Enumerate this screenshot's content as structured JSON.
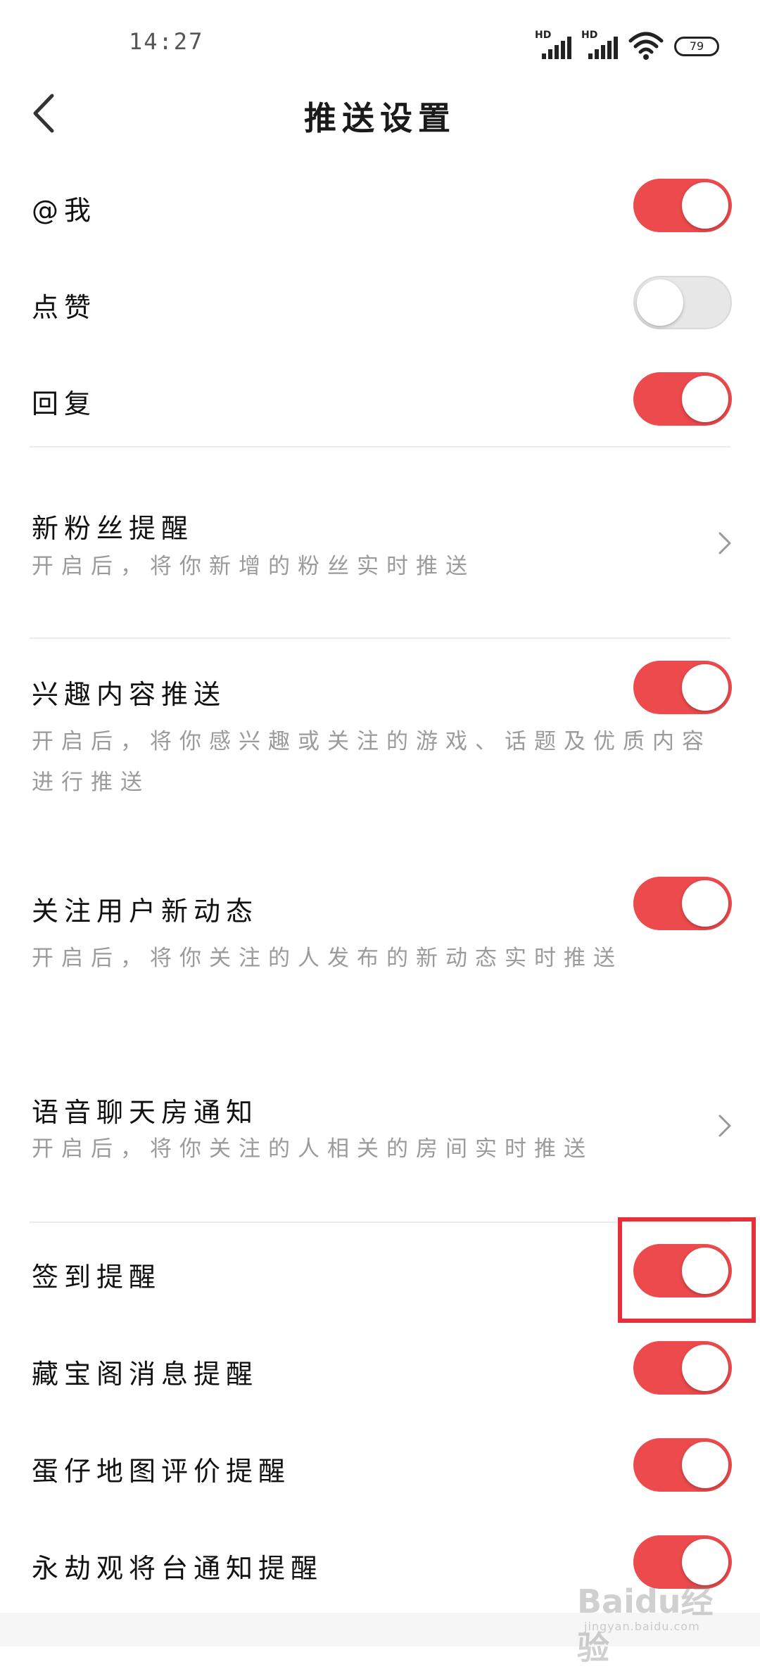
{
  "status_bar": {
    "time": "14:27",
    "signal_1_label": "HD",
    "signal_2_label": "HD",
    "battery_level": "79"
  },
  "header": {
    "title": "推送设置",
    "back_icon": "chevron-left-icon"
  },
  "settings": {
    "mention": {
      "label": "@我",
      "enabled": true
    },
    "like": {
      "label": "点赞",
      "enabled": false
    },
    "reply": {
      "label": "回复",
      "enabled": true
    },
    "new_fans": {
      "label": "新粉丝提醒",
      "desc": "开启后，将你新增的粉丝实时推送"
    },
    "interest": {
      "label": "兴趣内容推送",
      "desc": "开启后，将你感兴趣或关注的游戏、话题及优质内容进行推送",
      "enabled": true
    },
    "follow_updates": {
      "label": "关注用户新动态",
      "desc": "开启后，将你关注的人发布的新动态实时推送",
      "enabled": true
    },
    "voice_room": {
      "label": "语音聊天房通知",
      "desc": "开启后，将你关注的人相关的房间实时推送"
    },
    "checkin": {
      "label": "签到提醒",
      "enabled": true
    },
    "treasure": {
      "label": "藏宝阁消息提醒",
      "enabled": true
    },
    "map_review": {
      "label": "蛋仔地图评价提醒",
      "enabled": true
    },
    "yongjie": {
      "label": "永劫观将台通知提醒",
      "enabled": true
    }
  },
  "watermark": {
    "text": "Baidu经验",
    "sub": "jingyan.baidu.com"
  },
  "colors": {
    "accent": "#ec4a4c",
    "toggle_off": "#e7e7e7",
    "desc_text": "#9b9b9b",
    "highlight": "#e5303a"
  }
}
